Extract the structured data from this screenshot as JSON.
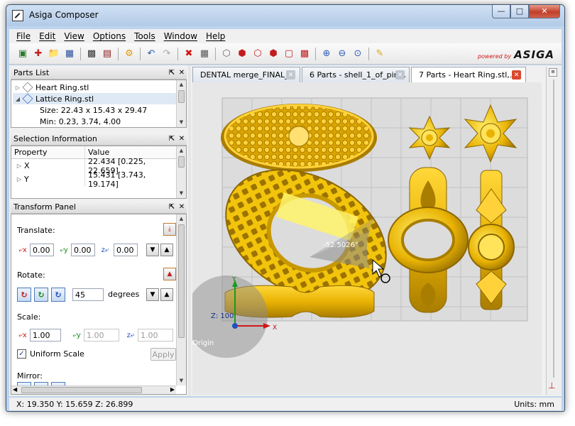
{
  "window": {
    "title": "Asiga Composer"
  },
  "menu": [
    "File",
    "Edit",
    "View",
    "Options",
    "Tools",
    "Window",
    "Help"
  ],
  "toolbar": {
    "icons": [
      "import-icon",
      "add-support-icon",
      "open-folder-icon",
      "save-icon",
      "layout-icon",
      "support-icon",
      "gear-icon",
      "undo-icon",
      "redo-icon",
      "delete-icon",
      "select-icon",
      "view-iso-icon",
      "view-front-icon",
      "view-back-icon",
      "view-left-icon",
      "view-right-icon",
      "view-top-icon",
      "zoom-in-icon",
      "zoom-out-icon",
      "zoom-fit-icon",
      "measure-icon"
    ],
    "powered_by": "powered by",
    "brand": "ASIGA"
  },
  "parts_list": {
    "title": "Parts List",
    "items": [
      {
        "name": "Heart Ring.stl"
      },
      {
        "name": "Lattice Ring.stl"
      }
    ],
    "details": [
      "Size: 22.43 x 15.43 x 29.47",
      "Min: 0.23, 3.74, 4.00"
    ]
  },
  "selection_info": {
    "title": "Selection Information",
    "headers": [
      "Property",
      "Value"
    ],
    "rows": [
      {
        "property": "X",
        "value": "22.434 [0.225, 22.659]"
      },
      {
        "property": "Y",
        "value": "15.431 [3.743, 19.174]"
      }
    ]
  },
  "transform": {
    "title": "Transform Panel",
    "translate_label": "Translate:",
    "translate": {
      "x": "0.00",
      "y": "0.00",
      "z": "0.00"
    },
    "rotate_label": "Rotate:",
    "rotate_value": "45",
    "rotate_unit": "degrees",
    "scale_label": "Scale:",
    "scale": {
      "x": "1.00",
      "y": "1.00",
      "z": "1.00"
    },
    "uniform_scale": "Uniform Scale",
    "apply": "Apply",
    "mirror_label": "Mirror:"
  },
  "tabs": [
    {
      "label": "DENTAL merge_FINAL_..."
    },
    {
      "label": "6 Parts - shell_1_of_pin..."
    },
    {
      "label": "7 Parts - Heart Ring.stl,..."
    }
  ],
  "viewport": {
    "angle_label": "-52.5026°",
    "z_label": "Z: 100",
    "origin_label": "Origin",
    "axis_y": "Y",
    "axis_x": "X"
  },
  "status": {
    "coords": "X: 19.350  Y: 15.659  Z: 26.899",
    "units": "Units: mm"
  },
  "colors": {
    "gold": "#e9b304",
    "gold_dark": "#a97d00",
    "accent": "#d01818"
  }
}
